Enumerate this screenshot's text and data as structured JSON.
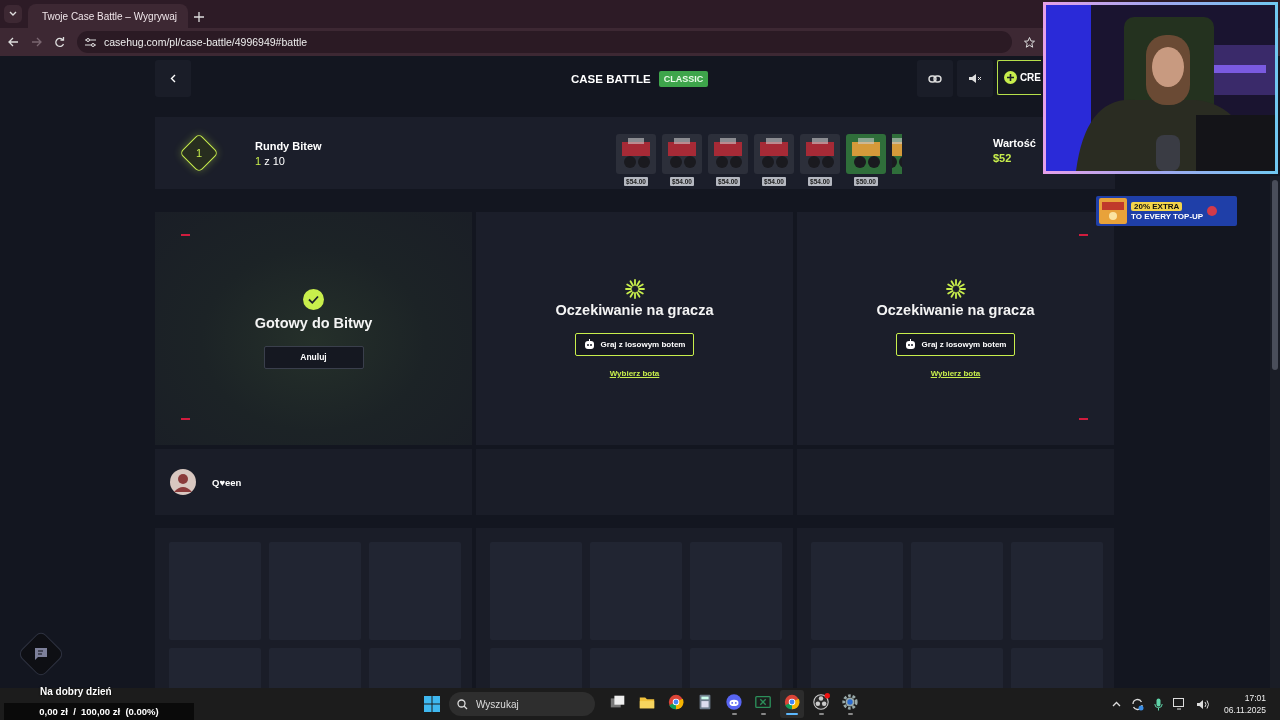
{
  "browser": {
    "tabs": [
      {
        "title": "Twoje Case Battle – Wygrywaj",
        "selected": true
      }
    ],
    "url": "casehug.com/pl/case-battle/4996949#battle"
  },
  "header": {
    "title": "CASE BATTLE",
    "mode": "CLASSIC",
    "action": "CRE"
  },
  "rounds": {
    "badge": "1",
    "label": "Rundy Bitew",
    "current": "1",
    "total": "z 10",
    "value_label": "Wartość",
    "value": "$52",
    "cases": [
      {
        "kind": "red",
        "price": "$54.00"
      },
      {
        "kind": "red",
        "price": "$54.00"
      },
      {
        "kind": "red",
        "price": "$54.00"
      },
      {
        "kind": "red",
        "price": "$54.00"
      },
      {
        "kind": "red",
        "price": "$54.00"
      },
      {
        "kind": "green",
        "price": "$50.00"
      },
      {
        "kind": "cut"
      }
    ]
  },
  "slots": [
    {
      "kind": "ready",
      "status": "Gotowy do Bitwy",
      "button": "Anuluj"
    },
    {
      "kind": "waiting",
      "status": "Oczekiwanie na gracza",
      "button": "Graj z losowym botem",
      "link": "Wybierz bota"
    },
    {
      "kind": "waiting",
      "status": "Oczekiwanie na gracza",
      "button": "Graj z losowym botem",
      "link": "Wybierz bota"
    }
  ],
  "players": [
    {
      "kind": "player",
      "name": "Q♥een"
    },
    {
      "kind": "empty"
    },
    {
      "kind": "empty"
    }
  ],
  "overlay": {
    "greeting": "Na dobry dzień",
    "progress": "0,00 zł  /  100,00 zł  (0.00%)",
    "banner_headline": "20% EXTRA",
    "banner_subline": "TO EVERY TOP-UP"
  },
  "taskbar": {
    "search": {
      "placeholder": "Wyszukaj"
    },
    "apps": [
      {
        "kind": "taskview",
        "running": false,
        "active": false
      },
      {
        "kind": "folder",
        "running": false,
        "active": false
      },
      {
        "kind": "chrome",
        "running": false,
        "active": false
      },
      {
        "kind": "calculator",
        "running": false,
        "active": false
      },
      {
        "kind": "discord",
        "running": true,
        "active": false
      },
      {
        "kind": "sheet",
        "running": true,
        "active": false
      },
      {
        "kind": "chrome",
        "running": true,
        "active": true
      },
      {
        "kind": "obs",
        "running": true,
        "active": false
      },
      {
        "kind": "gear",
        "running": true,
        "active": false
      }
    ],
    "time": "17:01",
    "date": "06.11.2025"
  }
}
